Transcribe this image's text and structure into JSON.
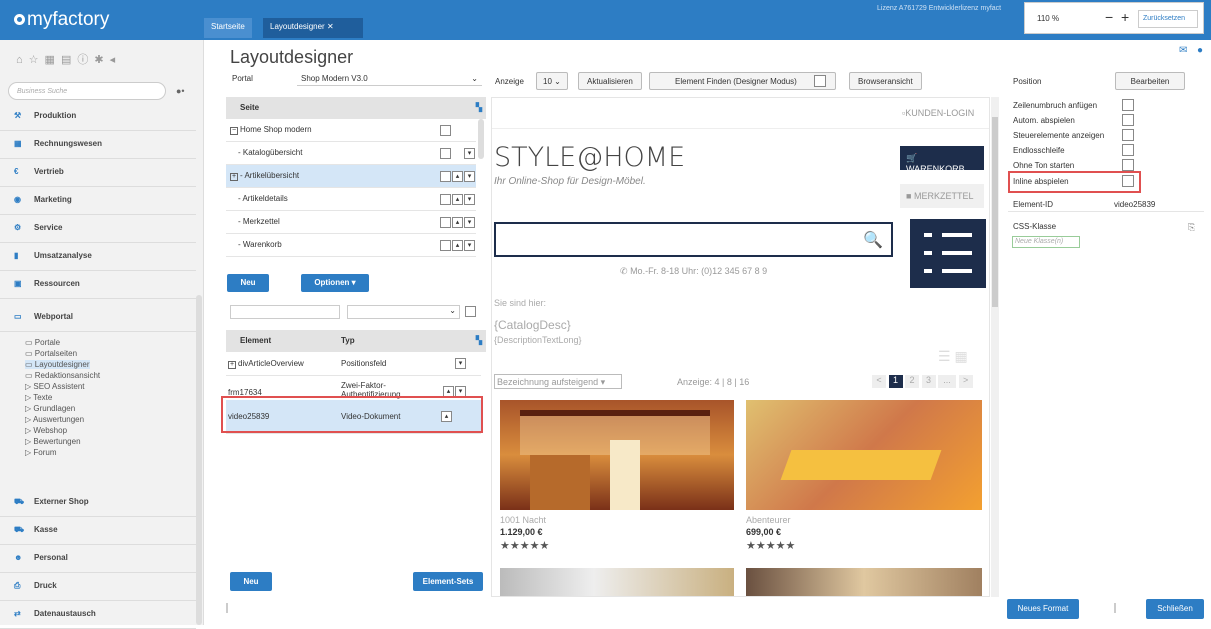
{
  "app": {
    "logo": "myfactory",
    "licence": "Lizenz A761729 Entwicklerlizenz myfact"
  },
  "tabs": [
    {
      "label": "Startseite"
    },
    {
      "label": "Layoutdesigner"
    }
  ],
  "zoom": {
    "value": "110 %",
    "reset_label": "Zurücksetzen"
  },
  "sidebar": {
    "search_placeholder": "Business Suche",
    "nav": [
      {
        "label": "Produktion",
        "icon": "wrench-icon"
      },
      {
        "label": "Rechnungswesen",
        "icon": "grid-icon"
      },
      {
        "label": "Vertrieb",
        "icon": "euro-icon"
      },
      {
        "label": "Marketing",
        "icon": "megaphone-icon"
      },
      {
        "label": "Service",
        "icon": "gear-icon"
      },
      {
        "label": "Umsatzanalyse",
        "icon": "barchart-icon"
      },
      {
        "label": "Ressourcen",
        "icon": "document-icon"
      },
      {
        "label": "Webportal",
        "icon": "monitor-icon"
      }
    ],
    "sub": [
      "Portale",
      "Portalseiten",
      "Layoutdesigner",
      "Redaktionsansicht",
      "SEO Assistent",
      "Texte",
      "Grundlagen",
      "Auswertungen",
      "Webshop",
      "Bewertungen",
      "Forum"
    ],
    "nav2": [
      {
        "label": "Externer Shop"
      },
      {
        "label": "Kasse"
      },
      {
        "label": "Personal"
      },
      {
        "label": "Druck"
      },
      {
        "label": "Datenaustausch"
      }
    ]
  },
  "main": {
    "title": "Layoutdesigner",
    "portal_label": "Portal",
    "portal_value": "Shop Modern V3.0",
    "seite_header": "Seite",
    "tree": [
      "Home Shop modern",
      "- Katalogübersicht",
      "- Artikelübersicht",
      "- Artikeldetails",
      "- Merkzettel",
      "- Warenkorb"
    ],
    "new_label": "Neu",
    "options_label": "Optionen",
    "element_header": "Element",
    "type_header": "Typ",
    "elements": [
      {
        "name": "divArticleOverview",
        "type": "Positionsfeld"
      },
      {
        "name": "frm17634",
        "type": "Zwei-Faktor-Authentifizierung"
      },
      {
        "name": "video25839",
        "type": "Video-Dokument"
      }
    ],
    "new2_label": "Neu",
    "elementsets_label": "Element-Sets"
  },
  "toolbar": {
    "anzeige_label": "Anzeige",
    "anzeige_value": "10",
    "refresh": "Aktualisieren",
    "find": "Element Finden (Designer Modus)",
    "browser": "Browseransicht"
  },
  "preview": {
    "login": "KUNDEN-LOGIN",
    "brand": "STYLE@HOME",
    "tagline": "Ihr Online-Shop für Design-Möbel.",
    "cart": "WARENKORB",
    "wishlist": "MERKZETTEL",
    "phone": "Mo.-Fr. 8-18 Uhr: (0)12 345 67 8 9",
    "crumb": "Sie sind hier:",
    "catdesc": "{CatalogDesc}",
    "desclong": "{DescriptionTextLong}",
    "sort": "Bezeichnung aufsteigend",
    "show": "Anzeige:  4  |  8  |  16",
    "pages": [
      "<",
      "1",
      "2",
      "3",
      "...",
      ">"
    ],
    "products": [
      {
        "name": "1001 Nacht",
        "price": "1.129,00 €",
        "stars": "★★★★★"
      },
      {
        "name": "Abenteurer",
        "price": "699,00 €",
        "stars": "★★★★★"
      }
    ]
  },
  "right": {
    "position_label": "Position",
    "edit_label": "Bearbeiten",
    "options": [
      "Zeilenumbruch anfügen",
      "Autom. abspielen",
      "Steuerelemente anzeigen",
      "Endlosschleife",
      "Ohne Ton starten",
      "Inline abspielen"
    ],
    "elementid_label": "Element-ID",
    "elementid_value": "video25839",
    "css_label": "CSS-Klasse",
    "css_placeholder": "Neue Klasse(n)",
    "newformat_label": "Neues Format",
    "close_label": "Schließen"
  }
}
